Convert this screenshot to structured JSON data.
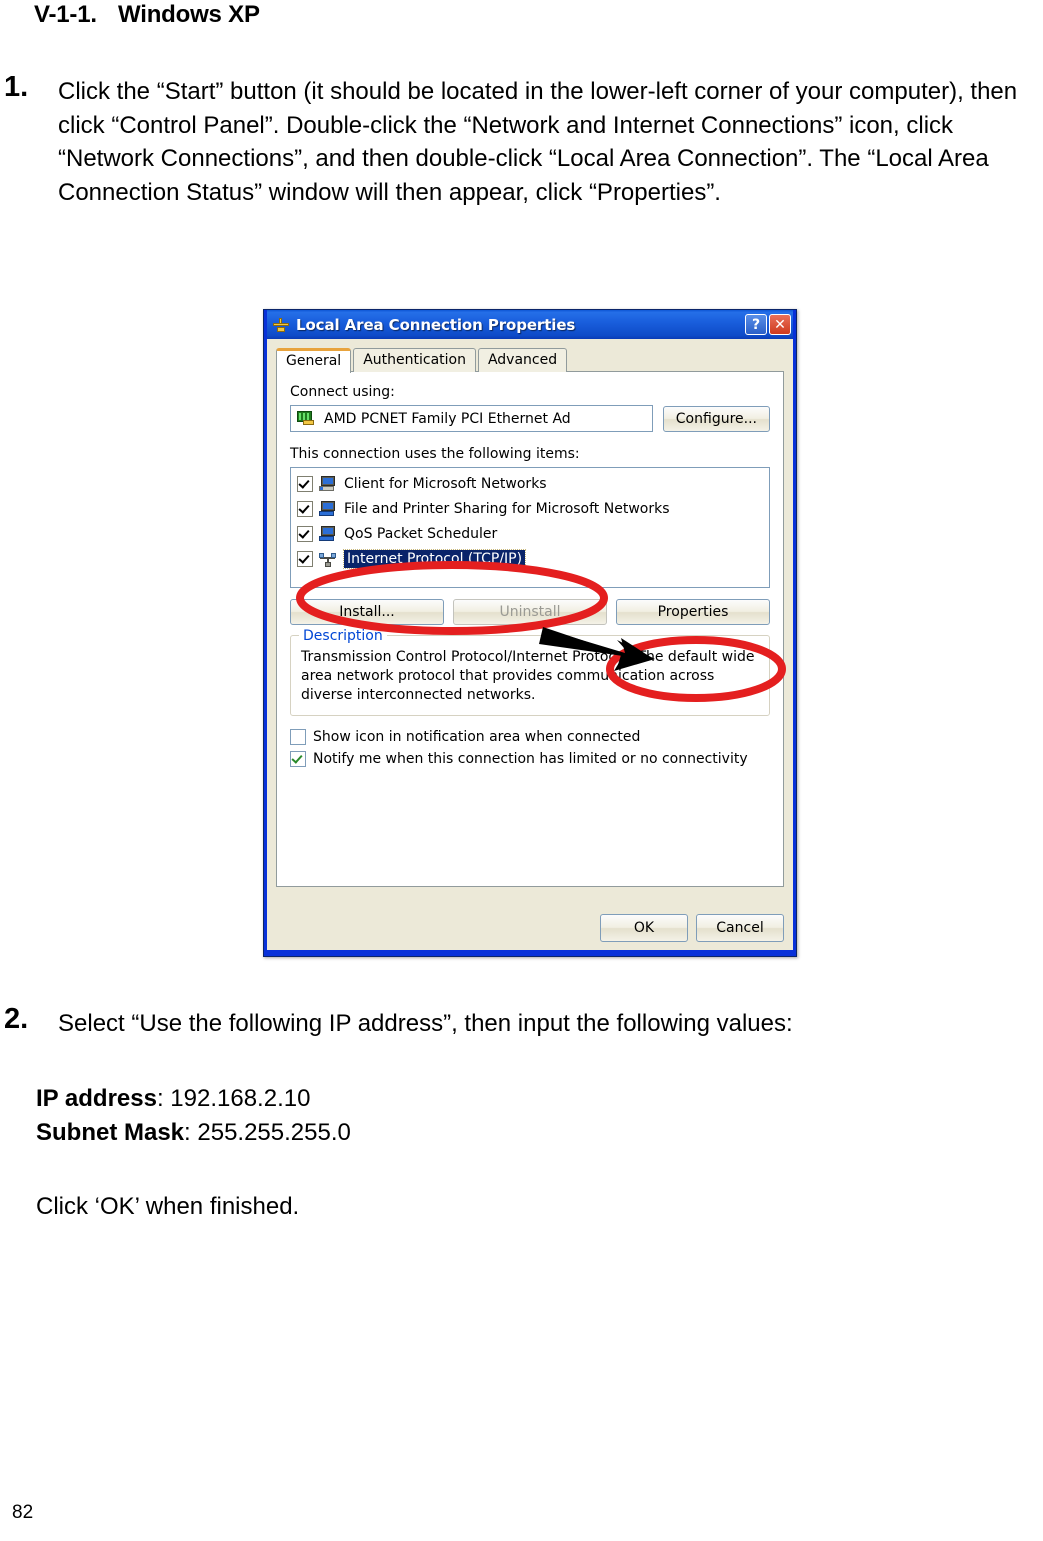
{
  "document": {
    "heading_number": "V-1-1.",
    "heading_title": "Windows XP",
    "step1_number": "1.",
    "step1_text": "Click the “Start” button (it should be located in the lower-left corner of your computer), then click “Control Panel”. Double-click the “Network and Internet Connections” icon, click “Network Connections”, and then double-click “Local Area Connection”. The “Local Area Connection Status” window will then appear, click “Properties”.",
    "step2_number": "2.",
    "step2_text": "Select “Use the following IP address”, then input the following values:",
    "value_ip_label": "IP address",
    "value_ip": ": 192.168.2.10",
    "value_mask_label": "Subnet Mask",
    "value_mask": ": 255.255.255.0",
    "closing_text": "Click ‘OK’ when finished.",
    "page_number": "82"
  },
  "dialog": {
    "title": "Local Area Connection Properties",
    "title_icon": "network-connection-icon",
    "help_button": "?",
    "close_button": "✕",
    "tabs": [
      {
        "label": "General",
        "active": true
      },
      {
        "label": "Authentication",
        "active": false
      },
      {
        "label": "Advanced",
        "active": false
      }
    ],
    "connect_using_label": "Connect using:",
    "adapter_name": "AMD PCNET Family PCI Ethernet Ad",
    "configure_button": "Configure...",
    "items_label": "This connection uses the following items:",
    "items": [
      {
        "label": "Client for Microsoft Networks",
        "checked": true,
        "selected": false,
        "icon": "client-computer-icon"
      },
      {
        "label": "File and Printer Sharing for Microsoft Networks",
        "checked": true,
        "selected": false,
        "icon": "file-sharing-computer-icon"
      },
      {
        "label": "QoS Packet Scheduler",
        "checked": true,
        "selected": false,
        "icon": "qos-computer-icon"
      },
      {
        "label": "Internet Protocol (TCP/IP)",
        "checked": true,
        "selected": true,
        "icon": "protocol-network-icon"
      }
    ],
    "install_button": "Install...",
    "uninstall_button": "Uninstall",
    "properties_button": "Properties",
    "description_title": "Description",
    "description_text": "Transmission Control Protocol/Internet Protocol. The default wide area network protocol that provides communication across diverse interconnected networks.",
    "option_show_icon": "Show icon in notification area when connected",
    "option_show_icon_checked": false,
    "option_notify": "Notify me when this connection has limited or no connectivity",
    "option_notify_checked": true,
    "ok_button": "OK",
    "cancel_button": "Cancel"
  },
  "annotations": {
    "highlight_color": "#e41f1f",
    "arrow_color": "#000000",
    "ellipse_protocol": "highlight-internet-protocol-item",
    "ellipse_properties": "highlight-properties-button",
    "arrow": "arrow-pointing-to-properties-button"
  }
}
